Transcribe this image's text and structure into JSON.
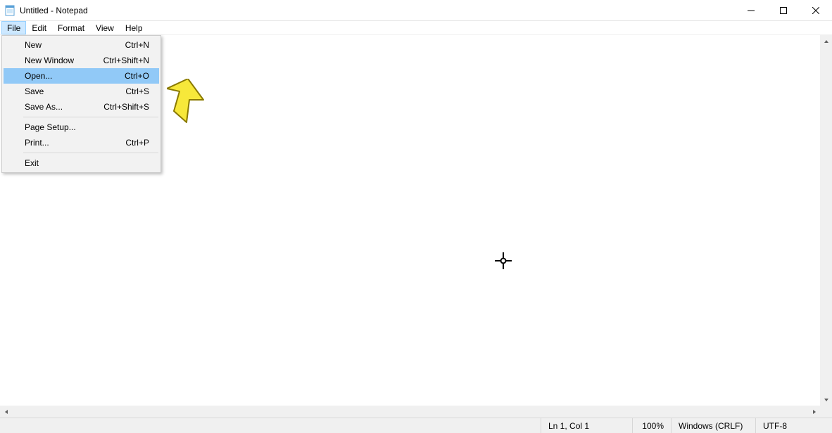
{
  "window": {
    "title": "Untitled - Notepad"
  },
  "menubar": {
    "file": "File",
    "edit": "Edit",
    "format": "Format",
    "view": "View",
    "help": "Help"
  },
  "fileMenu": {
    "new": {
      "label": "New",
      "shortcut": "Ctrl+N"
    },
    "newWindow": {
      "label": "New Window",
      "shortcut": "Ctrl+Shift+N"
    },
    "open": {
      "label": "Open...",
      "shortcut": "Ctrl+O"
    },
    "save": {
      "label": "Save",
      "shortcut": "Ctrl+S"
    },
    "saveAs": {
      "label": "Save As...",
      "shortcut": "Ctrl+Shift+S"
    },
    "pageSetup": {
      "label": "Page Setup...",
      "shortcut": ""
    },
    "print": {
      "label": "Print...",
      "shortcut": "Ctrl+P"
    },
    "exit": {
      "label": "Exit",
      "shortcut": ""
    }
  },
  "status": {
    "lncol": "Ln 1, Col 1",
    "zoom": "100%",
    "lineEnding": "Windows (CRLF)",
    "encoding": "UTF-8"
  }
}
